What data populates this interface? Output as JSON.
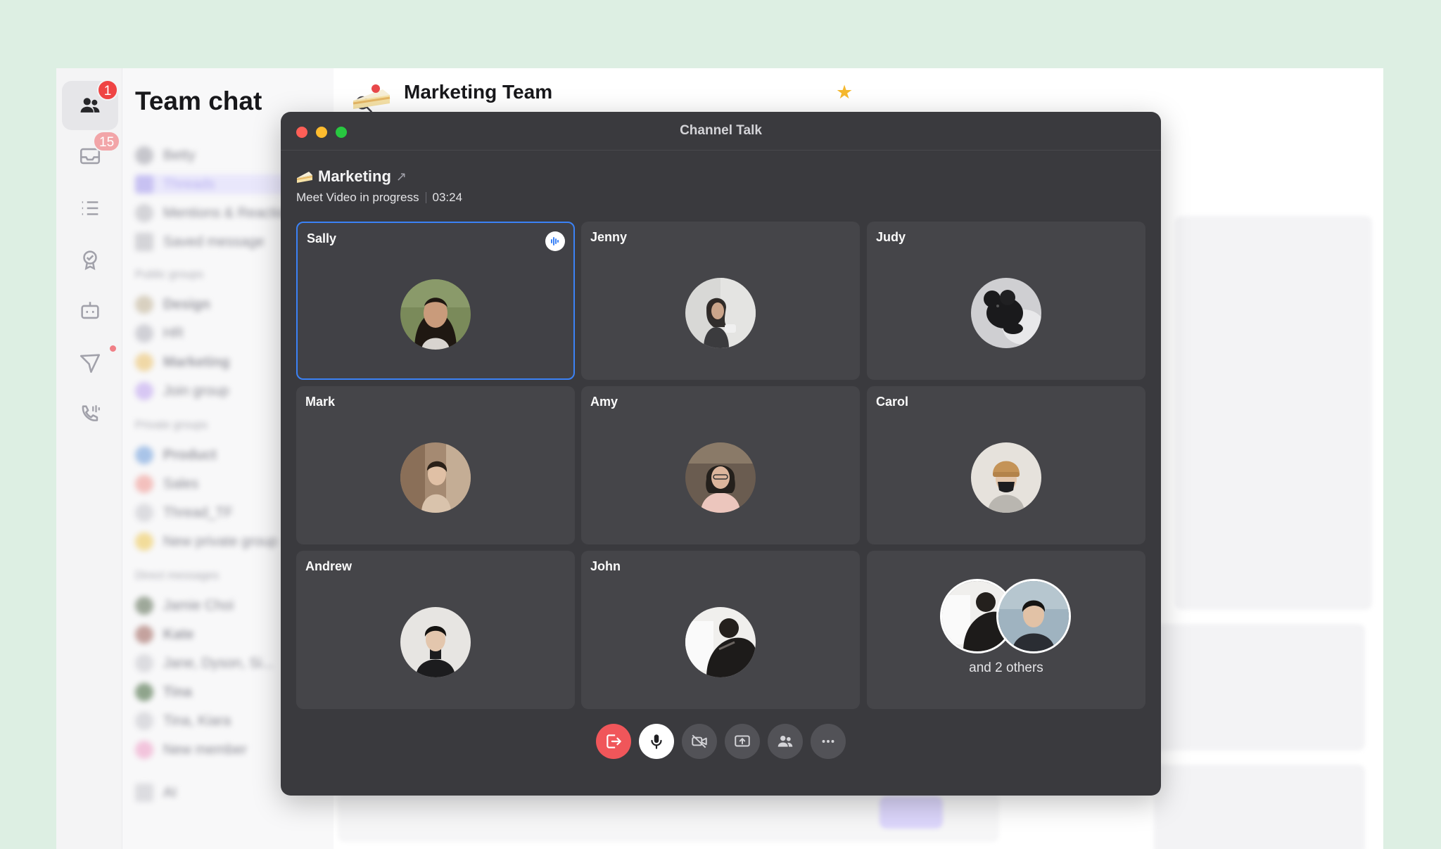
{
  "app": {
    "sidebar_title": "Team chat",
    "channel_title": "Marketing Team",
    "rail": {
      "team_badge": "1",
      "inbox_badge": "15"
    },
    "sidebar_rows": [
      "Betty",
      "Threads",
      "Mentions & Reactions",
      "Saved message",
      "Public groups",
      "Design",
      "HR",
      "Marketing",
      "Join group",
      "Private groups",
      "Product",
      "Sales",
      "Thread_TF",
      "New private group",
      "Direct messages",
      "Jamie Choi",
      "Kate",
      "Jane, Dyson, Si...",
      "Tina",
      "Tina, Kiara",
      "New member",
      "AI"
    ]
  },
  "call": {
    "window_title": "Channel Talk",
    "channel_name": "Marketing",
    "status_text": "Meet Video in progress",
    "timer": "03:24",
    "participants": [
      {
        "name": "Sally",
        "speaking": true
      },
      {
        "name": "Jenny",
        "speaking": false
      },
      {
        "name": "Judy",
        "speaking": false
      },
      {
        "name": "Mark",
        "speaking": false
      },
      {
        "name": "Amy",
        "speaking": false
      },
      {
        "name": "Carol",
        "speaking": false
      },
      {
        "name": "Andrew",
        "speaking": false
      },
      {
        "name": "John",
        "speaking": false
      }
    ],
    "others_text": "and 2 others",
    "controls": [
      "leave-icon",
      "microphone-icon",
      "camera-off-icon",
      "screen-share-icon",
      "participants-icon",
      "more-icon"
    ]
  },
  "colors": {
    "background": "#ddefe3",
    "call_window": "#3a3a3e",
    "tile": "#454549",
    "speaking_border": "#3b82f6",
    "leave_button": "#f0565a",
    "badge": "#ef4444",
    "star": "#f5b82e"
  }
}
